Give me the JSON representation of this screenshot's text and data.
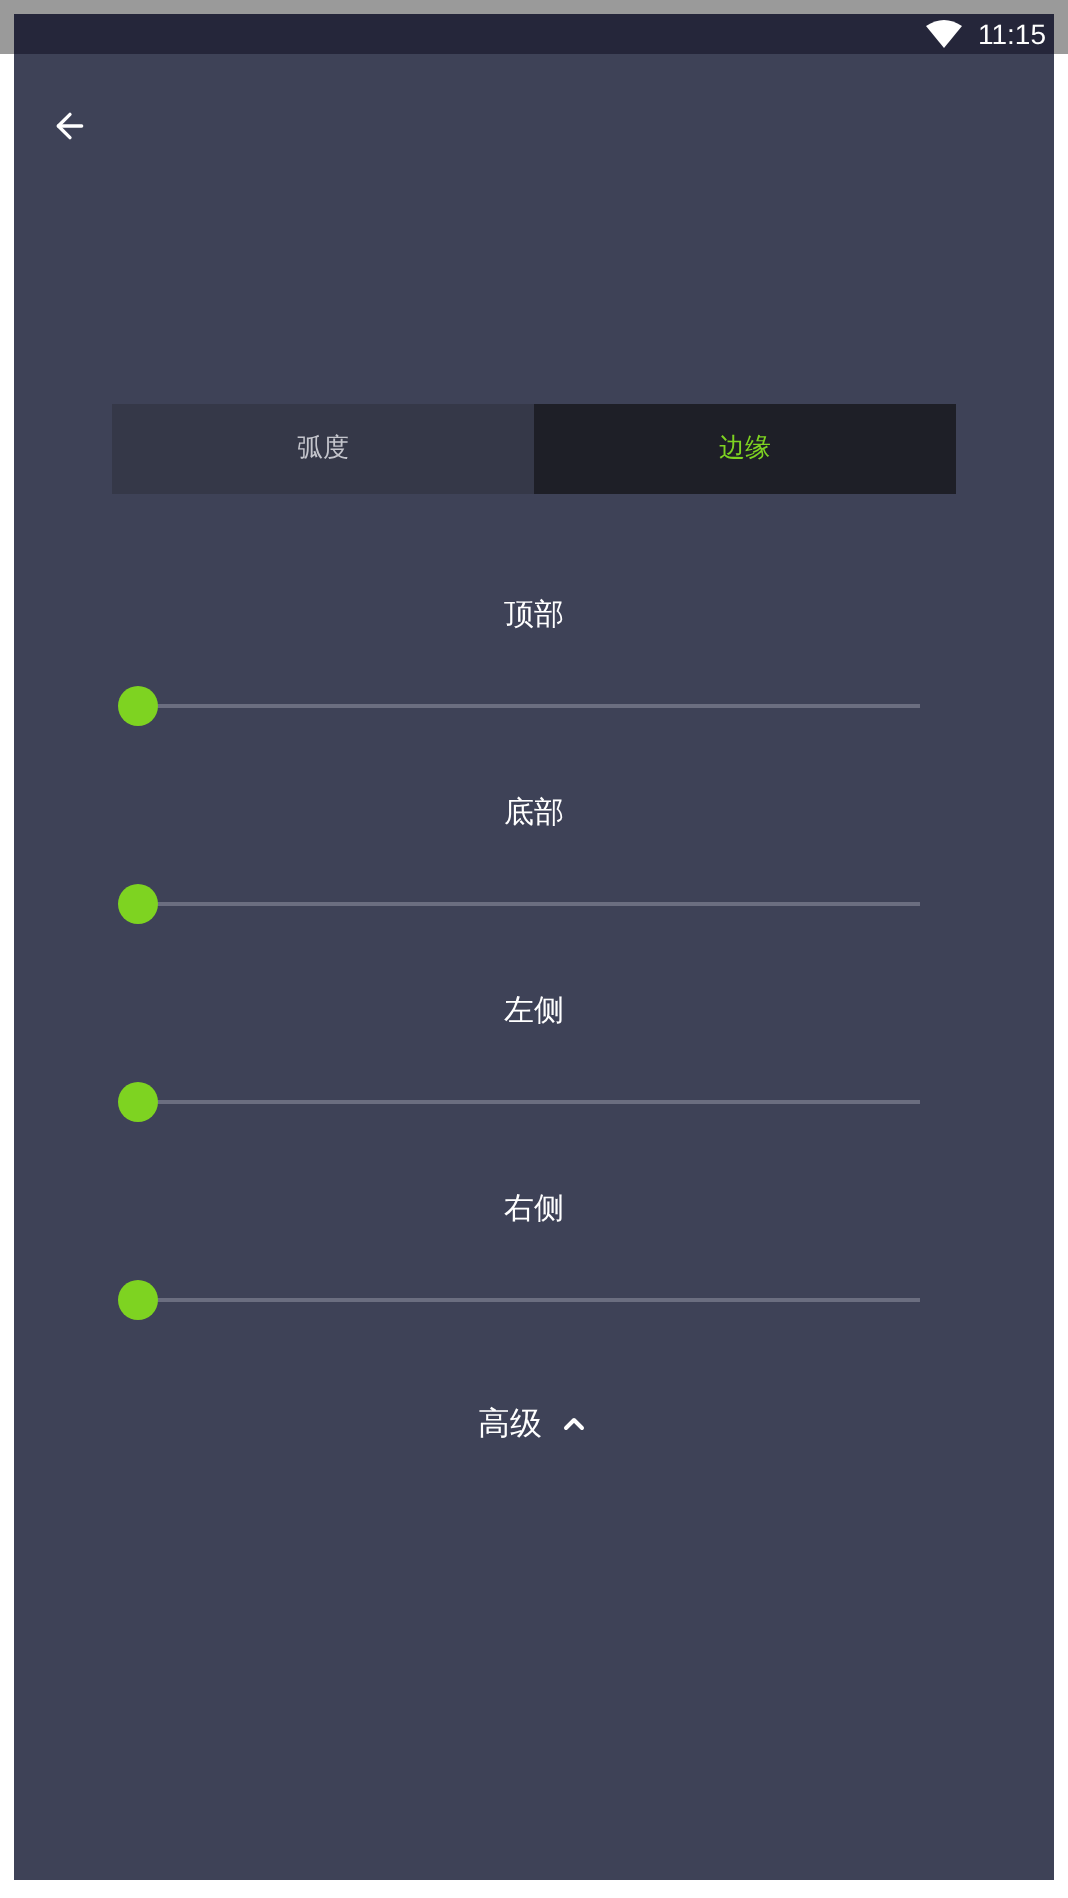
{
  "status_bar": {
    "time": "11:15"
  },
  "tabs": [
    {
      "label": "弧度",
      "selected": false
    },
    {
      "label": "边缘",
      "selected": true
    }
  ],
  "sliders": [
    {
      "label": "顶部",
      "level": 0
    },
    {
      "label": "底部",
      "level": 0
    },
    {
      "label": "左侧",
      "level": 0
    },
    {
      "label": "右侧",
      "level": 0
    }
  ],
  "advanced": {
    "label": "高级",
    "expanded": true
  }
}
